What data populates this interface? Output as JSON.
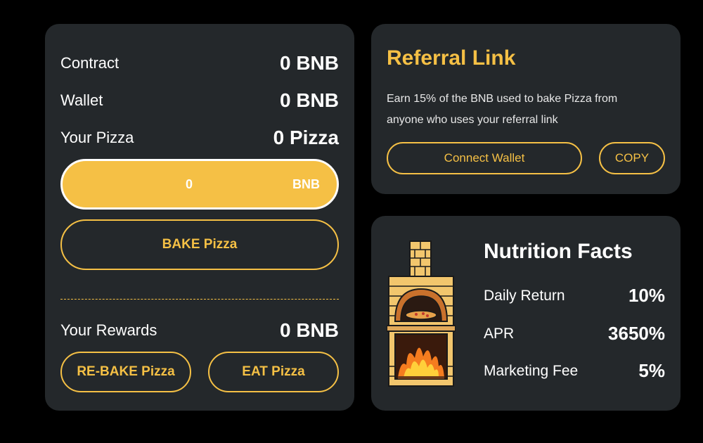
{
  "wallet_panel": {
    "contract_label": "Contract",
    "contract_value": "0 BNB",
    "wallet_label": "Wallet",
    "wallet_value": "0 BNB",
    "pizza_label": "Your Pizza",
    "pizza_value": "0 Pizza",
    "amount_input_value": "0",
    "amount_unit": "BNB",
    "bake_button": "BAKE Pizza",
    "rewards_label": "Your Rewards",
    "rewards_value": "0 BNB",
    "rebake_button": "RE-BAKE Pizza",
    "eat_button": "EAT Pizza"
  },
  "referral": {
    "title": "Referral Link",
    "description": "Earn 15% of the BNB used to bake Pizza from anyone who uses your referral link",
    "connect_button": "Connect Wallet",
    "copy_button": "COPY"
  },
  "nutrition": {
    "title": "Nutrition Facts",
    "rows": [
      {
        "label": "Daily Return",
        "value": "10%"
      },
      {
        "label": "APR",
        "value": "3650%"
      },
      {
        "label": "Marketing Fee",
        "value": "5%"
      }
    ],
    "oven_icon": "pizza-oven-icon"
  },
  "colors": {
    "accent": "#f5c045",
    "card_bg": "#24282b",
    "page_bg": "#000000"
  }
}
